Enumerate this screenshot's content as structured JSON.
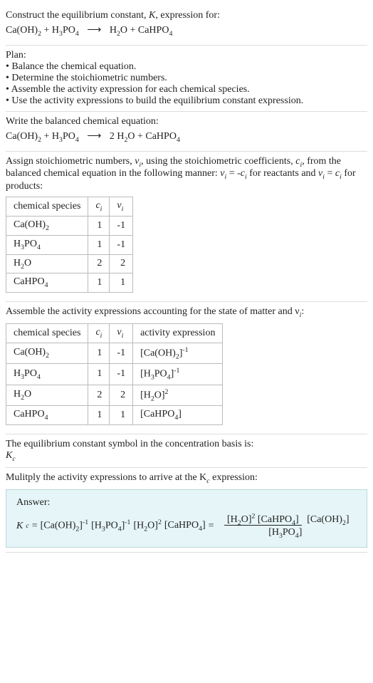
{
  "header": {
    "prompt": "Construct the equilibrium constant, K, expression for:"
  },
  "plan": {
    "title": "Plan:",
    "b1": "• Balance the chemical equation.",
    "b2": "• Determine the stoichiometric numbers.",
    "b3": "• Assemble the activity expression for each chemical species.",
    "b4": "• Use the activity expressions to build the equilibrium constant expression."
  },
  "balanced": {
    "title": "Write the balanced chemical equation:",
    "coef_h2o": "2"
  },
  "assign": {
    "line1": "Assign stoichiometric numbers, ν",
    "line1b": ", using the stoichiometric coefficients, c",
    "line1c": ", from the balanced chemical equation in the following manner: ν",
    "line1d": " = -c",
    "line1e": " for reactants and ν",
    "line1f": " = c",
    "line1g": " for products:",
    "sub_i": "i"
  },
  "table1": {
    "h1": "chemical species",
    "h2": "c",
    "h3": "ν",
    "rows": [
      {
        "sp": "Ca(OH)",
        "sub": "2",
        "c": "1",
        "v": "-1"
      },
      {
        "sp": "H",
        "sub": "3",
        "sp2": "PO",
        "sub2": "4",
        "c": "1",
        "v": "-1"
      },
      {
        "sp": "H",
        "sub": "2",
        "sp2": "O",
        "sub2": "",
        "c": "2",
        "v": "2"
      },
      {
        "sp": "CaHPO",
        "sub": "4",
        "c": "1",
        "v": "1"
      }
    ]
  },
  "assemble": {
    "title": "Assemble the activity expressions accounting for the state of matter and ν",
    "colon": ":"
  },
  "table2": {
    "h1": "chemical species",
    "h2": "c",
    "h3": "ν",
    "h4": "activity expression"
  },
  "eqconst": {
    "line": "The equilibrium constant symbol in the concentration basis is:",
    "symbol": "K",
    "sub_c": "c"
  },
  "multiply": {
    "line": "Mulitply the activity expressions to arrive at the K",
    "line2": " expression:"
  },
  "answer": {
    "label": "Answer:"
  },
  "chart_data": {
    "type": "table",
    "title": "Stoichiometric numbers and activity expressions",
    "tables": [
      {
        "columns": [
          "chemical species",
          "c_i",
          "ν_i"
        ],
        "rows": [
          [
            "Ca(OH)2",
            1,
            -1
          ],
          [
            "H3PO4",
            1,
            -1
          ],
          [
            "H2O",
            2,
            2
          ],
          [
            "CaHPO4",
            1,
            1
          ]
        ]
      },
      {
        "columns": [
          "chemical species",
          "c_i",
          "ν_i",
          "activity expression"
        ],
        "rows": [
          [
            "Ca(OH)2",
            1,
            -1,
            "[Ca(OH)2]^-1"
          ],
          [
            "H3PO4",
            1,
            -1,
            "[H3PO4]^-1"
          ],
          [
            "H2O",
            2,
            2,
            "[H2O]^2"
          ],
          [
            "CaHPO4",
            1,
            1,
            "[CaHPO4]"
          ]
        ]
      }
    ],
    "unbalanced_equation": "Ca(OH)2 + H3PO4 -> H2O + CaHPO4",
    "balanced_equation": "Ca(OH)2 + H3PO4 -> 2 H2O + CaHPO4",
    "Kc_expression": "Kc = [Ca(OH)2]^-1 [H3PO4]^-1 [H2O]^2 [CaHPO4] = ([H2O]^2 [CaHPO4]) / ([Ca(OH)2] [H3PO4])"
  }
}
